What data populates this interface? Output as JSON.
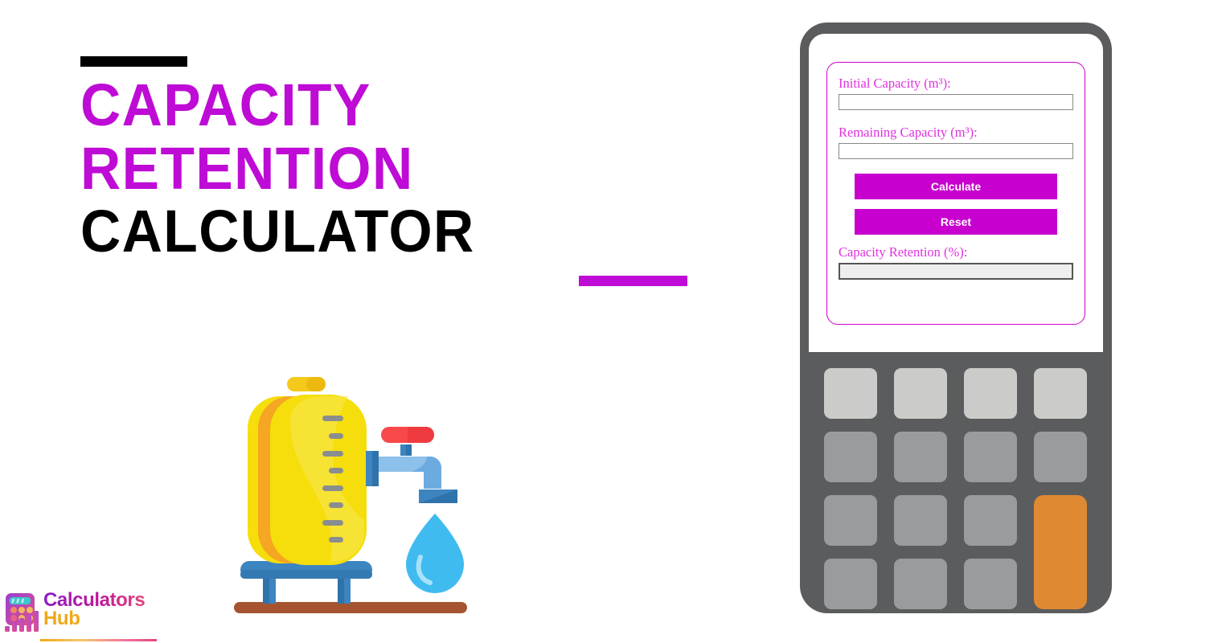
{
  "page": {
    "background": "#ffffff",
    "accent_magenta": "#bf0bd6",
    "accent_orange": "#df8a32",
    "device_gray": "#5b5c5e"
  },
  "title": {
    "line1": "CAPACITY",
    "line2": "RETENTION",
    "line3": "CALCULATOR",
    "rule_top_color": "#000000",
    "rule_bottom_color": "#bf0bd6"
  },
  "illustration": {
    "name": "water-tank-with-faucet",
    "tank_color": "#f5de0b",
    "tank_shadow_color": "#f5a623",
    "faucet_color": "#8dc0ea",
    "handle_color": "#f9484a",
    "droplet_color": "#3fbbf0",
    "stand_color": "#3d85c0",
    "base_color": "#a65430"
  },
  "logo": {
    "word1": "Calculators",
    "word2": "Hub",
    "icon": "calculator-bars-icon"
  },
  "calculator": {
    "form": {
      "fields": [
        {
          "label": "Initial Capacity (m³):",
          "value": "",
          "placeholder": "",
          "readonly": false
        },
        {
          "label": "Remaining Capacity (m³):",
          "value": "",
          "placeholder": "",
          "readonly": false
        }
      ],
      "buttons": [
        {
          "label": "Calculate",
          "name": "calculate-button"
        },
        {
          "label": "Reset",
          "name": "reset-button"
        }
      ],
      "result": {
        "label": "Capacity Retention (%):",
        "value": "",
        "readonly": true
      }
    },
    "keypad": {
      "rows": 4,
      "cols": 4,
      "keys": [
        {
          "tone": "light"
        },
        {
          "tone": "light"
        },
        {
          "tone": "light"
        },
        {
          "tone": "light"
        },
        {
          "tone": "normal"
        },
        {
          "tone": "normal"
        },
        {
          "tone": "normal"
        },
        {
          "tone": "normal"
        },
        {
          "tone": "normal"
        },
        {
          "tone": "normal"
        },
        {
          "tone": "normal"
        },
        {
          "tone": "accent"
        },
        {
          "tone": "normal"
        },
        {
          "tone": "normal"
        },
        {
          "tone": "normal"
        }
      ]
    }
  }
}
